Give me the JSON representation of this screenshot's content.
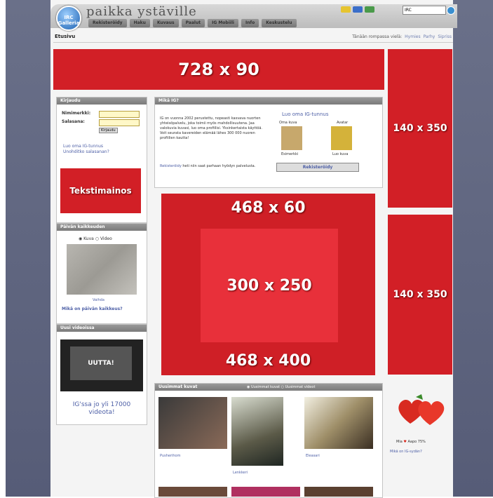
{
  "header": {
    "site_name": "paikka ystäville",
    "logo_text": "IRC Galleria",
    "nav": [
      "Rekisteröidy",
      "Haku",
      "Kuvaus",
      "Paalut",
      "IG Mobiili",
      "Info",
      "Keskustelu"
    ],
    "search_value": "IRC"
  },
  "crumb": {
    "title": "Etusivu",
    "right_text": "Tänään rompassa vielä:",
    "links": [
      "Hymies",
      "Parhy",
      "Sipriss"
    ]
  },
  "ads": {
    "top": "728 x 90",
    "right1": "140 x 350",
    "right2": "140 x 350",
    "mid_top": "468 x 60",
    "mid_center": "300 x 250",
    "mid_bottom": "468 x 400",
    "text_ad": "Tekstimainos"
  },
  "login": {
    "title": "Kirjaudu",
    "user_label": "Nimimerkki:",
    "pass_label": "Salasana:",
    "button": "Kirjaudu",
    "link1": "Luo oma IG-tunnus",
    "link2": "Unohditko salasanan?"
  },
  "intro": {
    "title": "Mikä IG?",
    "text": "IG on vuonna 2002 perustettu, nopeasti kasvava nuorten yhteisöpalvelu, joka toimii myös mahdollisuutena. Jaa valokuvia kuvasi, luo oma profiilisi. Yksinkertaista käyttöä. Voit seurata kavereiden elämää lähes 300 000 nuoren profiilien kautta!",
    "link_text": "Rekisteröidy",
    "text2": "heti niin saat parhaan hyödyn palvelusta.",
    "create_title": "Luo oma IG-tunnus",
    "own_photo": "Oma kuva",
    "avatar": "Avatar",
    "example1": "Esimerkki",
    "example2": "Luo kuva",
    "register_button": "Rekisteröidy"
  },
  "image_search": {
    "title": "Päivän kaikkeuden",
    "radio1": "Kuva",
    "radio2": "Video",
    "caption": "Vaihda",
    "link": "Mikä on päivän kaikkeus?"
  },
  "video": {
    "title": "Uusi videoissa",
    "badge": "UUTTA!",
    "text": "IG'ssa jo yli 17000 videota!"
  },
  "gallery": {
    "title": "Uusimmat kuvat",
    "option1": "Uusimmat kuvat",
    "option2": "Uusimmat videot",
    "names": [
      "Pusherihom",
      "Lenkkeri",
      "Eleasari"
    ]
  },
  "right_widget": {
    "text": "Mia",
    "text2": "Aapo 75%",
    "link": "Mikä on IG-sydän?"
  },
  "colors": {
    "ad_red": "#d21f26",
    "link_blue": "#4d5fa6",
    "header_grey": "#bcbcbc"
  }
}
